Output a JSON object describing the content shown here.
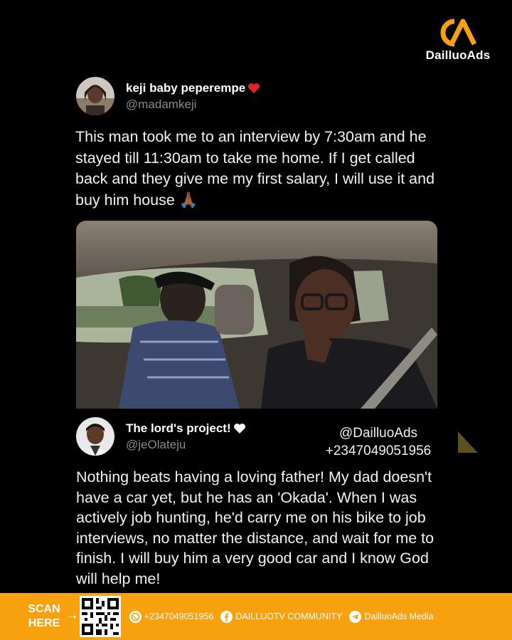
{
  "brand": {
    "name": "DailluoAds",
    "logo_mark": "DA",
    "accent_color": "#f7a10f"
  },
  "tweet1": {
    "display_name": "keji baby peperempe",
    "name_emoji": "red-heart",
    "handle": "@madamkeji",
    "text": "This man took me to an interview by 7:30am and he stayed till 11:30am to take me home. If I get called back and they give me my first salary, I will use it and buy him house",
    "text_emoji": "🙏🏾"
  },
  "tweet2": {
    "display_name": "The lord's project!",
    "name_emoji": "white-heart",
    "handle": "@jeOlateju",
    "text": "Nothing beats having a loving father! My dad doesn't have a car yet, but he has an 'Okada'. When I was actively job hunting, he'd carry me on his bike to job interviews, no matter the distance, and wait for me to finish. I will buy him a very good car and I know God will help me!"
  },
  "watermark": {
    "handle": "@DailluoAds",
    "phone": "+2347049051956"
  },
  "footer": {
    "scan_line1": "SCAN",
    "scan_line2": "HERE",
    "whatsapp": "+2347049051956",
    "facebook": "DAILLUOTV COMMUNITY",
    "telegram": "DailluoAds Media",
    "whatsapp_icon": "whatsapp-icon",
    "facebook_icon": "facebook-icon",
    "telegram_icon": "telegram-icon"
  }
}
